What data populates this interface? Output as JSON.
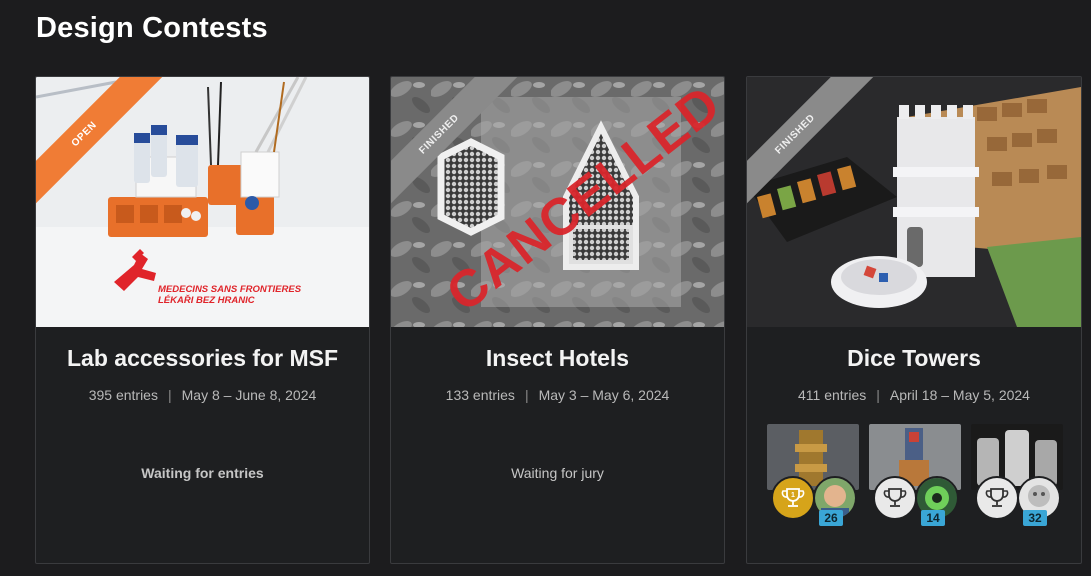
{
  "section": {
    "title": "Design Contests"
  },
  "contests": [
    {
      "ribbon": "OPEN",
      "image_text": {
        "line1": "MEDECINS SANS FRONTIERES",
        "line2": "LÉKAŘI BEZ HRANIC"
      },
      "title": "Lab accessories for MSF",
      "entries": "395 entries",
      "dates": "May 8 – June 8, 2024",
      "status": "Waiting for entries"
    },
    {
      "ribbon": "FINISHED",
      "stamp": "CANCELLED",
      "title": "Insect Hotels",
      "entries": "133 entries",
      "dates": "May 3 – May 6, 2024",
      "status": "Waiting for jury"
    },
    {
      "ribbon": "FINISHED",
      "title": "Dice Towers",
      "entries": "411 entries",
      "dates": "April 18 – May 5, 2024",
      "winners": [
        {
          "trophy": "1",
          "count": "26"
        },
        {
          "trophy": "",
          "count": "14"
        },
        {
          "trophy": "",
          "count": "32"
        }
      ]
    }
  ],
  "separator": "|",
  "colors": {
    "open": "#f07c35",
    "finished": "#8a8a8a",
    "cancelled": "#d9262c",
    "badge": "#3aa6d6",
    "gold": "#d6a41a"
  },
  "icons": [
    "trophy-icon",
    "msf-logo-icon"
  ]
}
